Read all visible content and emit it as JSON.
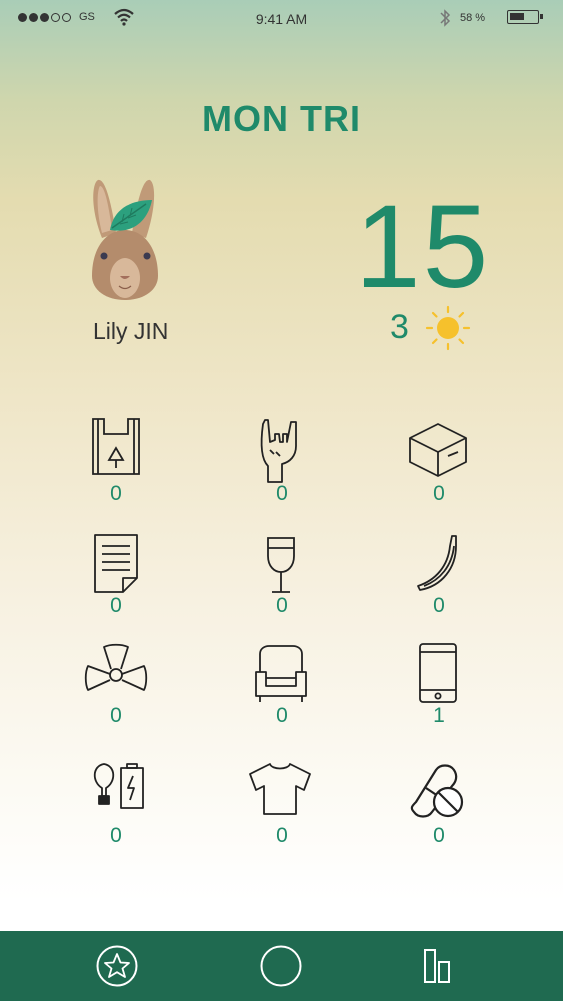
{
  "status_bar": {
    "carrier": "GS",
    "time": "9:41 AM",
    "battery_percent": "58 %",
    "battery_level": 0.58,
    "signal_bars_filled": 3,
    "signal_bars_total": 5
  },
  "header": {
    "title": "MON TRI"
  },
  "profile": {
    "name": "Lily JIN",
    "avatar_icon": "rabbit-leaf-avatar"
  },
  "score": {
    "value": "15",
    "sun_count": "3",
    "sun_icon": "sun-icon"
  },
  "categories": [
    {
      "icon": "plastic-bag-icon",
      "count": "0"
    },
    {
      "icon": "rock-hand-icon",
      "count": "0"
    },
    {
      "icon": "cardboard-box-icon",
      "count": "0"
    },
    {
      "icon": "paper-document-icon",
      "count": "0"
    },
    {
      "icon": "wine-glass-icon",
      "count": "0"
    },
    {
      "icon": "banana-icon",
      "count": "0"
    },
    {
      "icon": "radioactive-icon",
      "count": "0"
    },
    {
      "icon": "armchair-icon",
      "count": "0"
    },
    {
      "icon": "smartphone-icon",
      "count": "1"
    },
    {
      "icon": "bulb-battery-icon",
      "count": "0"
    },
    {
      "icon": "tshirt-icon",
      "count": "0"
    },
    {
      "icon": "pills-icon",
      "count": "0"
    }
  ],
  "tab_bar": {
    "tabs": [
      {
        "icon": "star-icon"
      },
      {
        "icon": "circle-icon"
      },
      {
        "icon": "bar-chart-icon"
      }
    ]
  },
  "colors": {
    "accent": "#1f8a6a",
    "tab_bar": "#1f6a50",
    "text": "#333333",
    "sun": "#f6c12c"
  }
}
